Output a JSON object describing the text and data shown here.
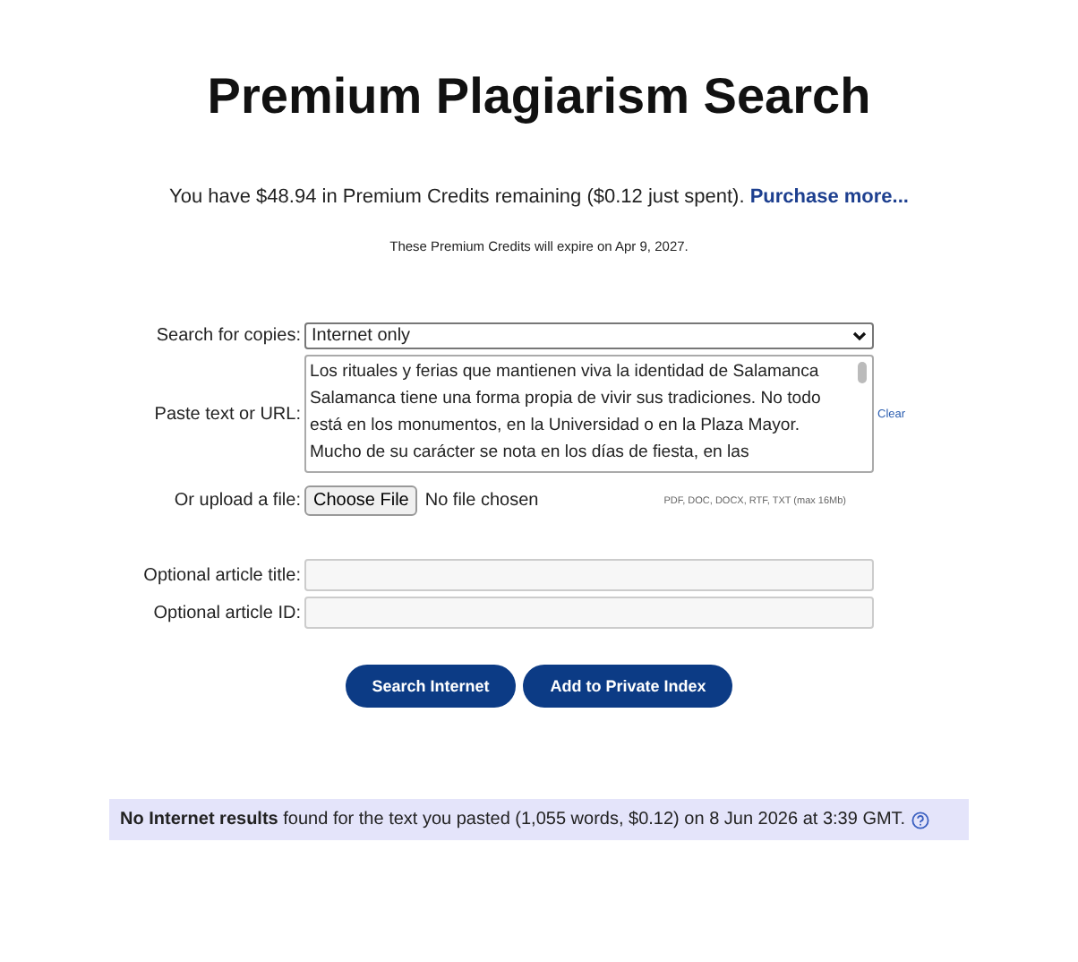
{
  "title": "Premium Plagiarism Search",
  "credits": {
    "text": "You have $48.94 in Premium Credits remaining ($0.12 just spent).",
    "link": "Purchase more..."
  },
  "expiry": "These Premium Credits will expire on Apr 9, 2027.",
  "form": {
    "search_label": "Search for copies:",
    "search_value": "Internet only",
    "paste_label": "Paste text or URL:",
    "paste_value": "Los rituales y ferias que mantienen viva la identidad de Salamanca Salamanca tiene una forma propia de vivir sus tradiciones. No todo está en los monumentos, en la Universidad o en la Plaza Mayor. Mucho de su carácter se nota en los días de fiesta, en las",
    "clear": "Clear",
    "upload_label": "Or upload a file:",
    "upload_button": "Choose File",
    "upload_status": "No file chosen",
    "upload_hint": "PDF, DOC, DOCX, RTF, TXT (max 16Mb)",
    "title_label": "Optional article title:",
    "id_label": "Optional article ID:"
  },
  "buttons": [
    "Search Internet",
    "Add to Private Index"
  ],
  "result": "**No Internet results** found for the text you pasted (1,055 words, $0.12) on 8 Jun 2026 at 3:39 GMT."
}
